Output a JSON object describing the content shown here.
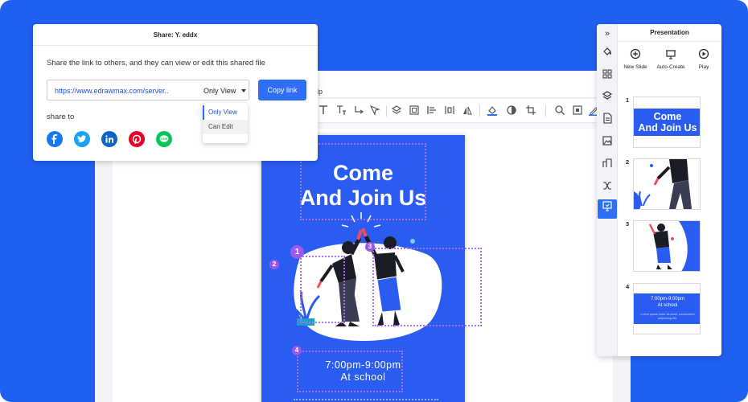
{
  "colors": {
    "background": "#1f60f0",
    "accent": "#2f6ef6",
    "poster": "#2b5cf2",
    "selection": "#a970f0",
    "marker": "#9b59e8"
  },
  "editor": {
    "menu_fragment": "lp",
    "toolbar_icons": [
      "text-icon",
      "text-box-icon",
      "connector-icon",
      "pointer-icon",
      "arrange-icon",
      "group-icon",
      "align-icon",
      "distribute-icon",
      "flip-icon",
      "fill-color-icon",
      "shape-style-icon",
      "crop-icon",
      "search-icon",
      "fit-page-icon",
      "pen-icon"
    ]
  },
  "poster": {
    "title": "Come\nAnd Join Us",
    "time": "7:00pm-9:00pm",
    "place": "At school",
    "markers": [
      "1",
      "2",
      "3",
      "4"
    ]
  },
  "share": {
    "title": "Share: Y. eddx",
    "description": "Share the link to others, and they can view or edit this shared file",
    "link_url": "https://www.edrawmax.com/server..",
    "link_mode": "Only View",
    "copy_button": "Copy link",
    "share_to_label": "share to",
    "dropdown_options": [
      "Only View",
      "Can Edit"
    ],
    "social": [
      {
        "name": "facebook",
        "glyph": "f",
        "color": "#1877f2"
      },
      {
        "name": "twitter",
        "glyph": "t",
        "color": "#1da1f2"
      },
      {
        "name": "linkedin",
        "glyph": "in",
        "color": "#0a66c2"
      },
      {
        "name": "pinterest",
        "glyph": "P",
        "color": "#e60023"
      },
      {
        "name": "line",
        "glyph": "LINE",
        "color": "#06c755"
      }
    ]
  },
  "presentation": {
    "title": "Presentation",
    "buttons": [
      {
        "label": "New Slide",
        "icon": "plus-circle-icon"
      },
      {
        "label": "Auto-Create",
        "icon": "auto-create-icon"
      },
      {
        "label": "Play",
        "icon": "play-icon"
      }
    ],
    "slides": [
      {
        "number": "1",
        "title": "Come\nAnd Join Us"
      },
      {
        "number": "2"
      },
      {
        "number": "3"
      },
      {
        "number": "4",
        "time": "7:00pm-9:00pm",
        "place": "At school",
        "body": "Lorem ipsum dolor sit amet, consectetur adipiscing elit."
      }
    ],
    "rail_icons": [
      "collapse-icon",
      "fill-icon",
      "grid-icon",
      "layers-icon",
      "page-icon",
      "image-icon",
      "data-icon",
      "shapes-icon",
      "presentation-icon"
    ]
  }
}
